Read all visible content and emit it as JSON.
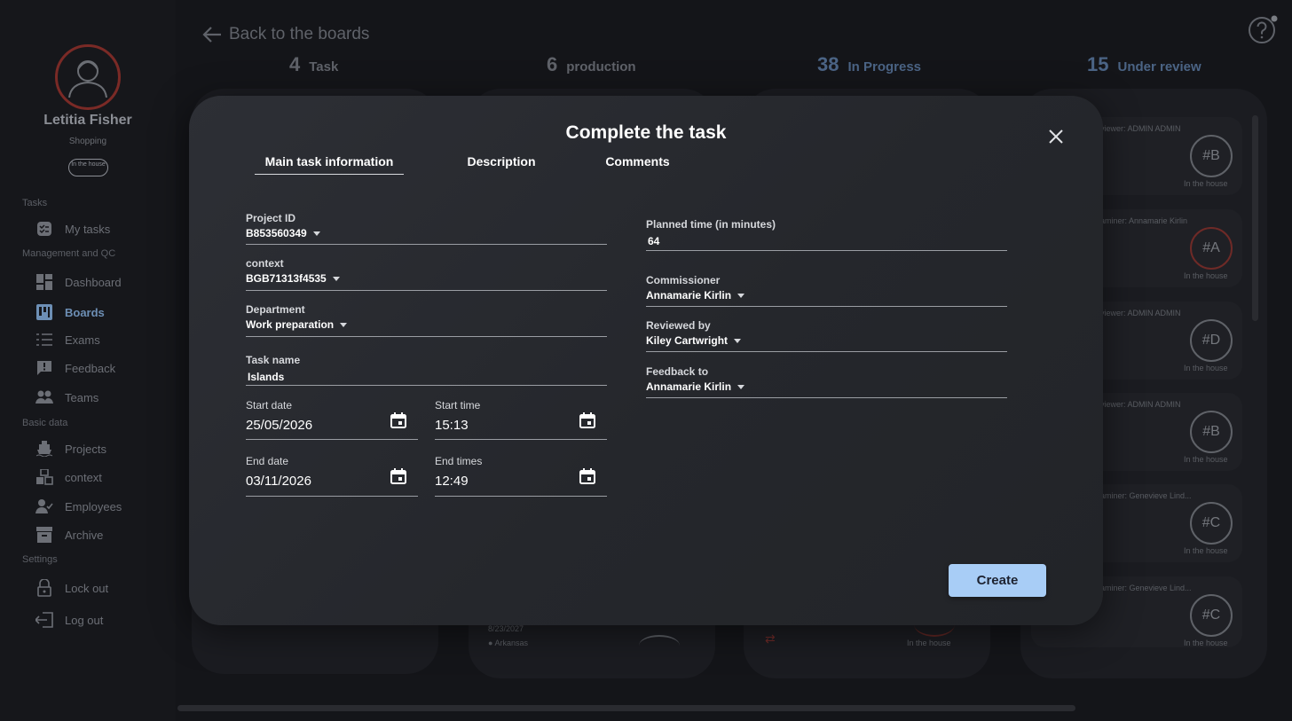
{
  "sidebar": {
    "user_name": "Letitia Fisher",
    "user_role": "Shopping",
    "user_status": "In the house",
    "sections": {
      "tasks": "Tasks",
      "management": "Management and QC",
      "basic": "Basic data",
      "settings": "Settings"
    },
    "items": {
      "my_tasks": "My tasks",
      "dashboard": "Dashboard",
      "boards": "Boards",
      "exams": "Exams",
      "feedback": "Feedback",
      "teams": "Teams",
      "projects": "Projects",
      "context": "context",
      "employees": "Employees",
      "archive": "Archive",
      "lock_out": "Lock out",
      "log_out": "Log out"
    }
  },
  "header": {
    "back_label": "Back to the boards"
  },
  "columns": [
    {
      "count": "4",
      "label": "Task"
    },
    {
      "count": "6",
      "label": "production"
    },
    {
      "count": "38",
      "label": "In Progress"
    },
    {
      "count": "15",
      "label": "Under review"
    }
  ],
  "review_cards": [
    {
      "who": "viewer: ADMIN ADMIN",
      "code": "#B",
      "loc": "In the house"
    },
    {
      "who": "aminer: Annamarie Kirlin",
      "code": "#A",
      "loc": "In the house"
    },
    {
      "who": "viewer: ADMIN ADMIN",
      "code": "#D",
      "loc": "In the house"
    },
    {
      "who": "viewer: ADMIN ADMIN",
      "code": "#B",
      "loc": "In the house"
    },
    {
      "who": "aminer: Genevieve Lind...",
      "code": "#C",
      "loc": "In the house"
    },
    {
      "who": "aminer: Genevieve Lind...",
      "code": "#C",
      "loc": "In the house"
    }
  ],
  "peek": {
    "date": "8/23/2027",
    "text": "● Arkansas",
    "loc": "In the house"
  },
  "modal": {
    "title": "Complete the task",
    "tabs": {
      "main": "Main task information",
      "description": "Description",
      "comments": "Comments"
    },
    "fields": {
      "project_id": {
        "label": "Project ID",
        "value": "B853560349"
      },
      "context": {
        "label": "context",
        "value": "BGB71313f4535"
      },
      "department": {
        "label": "Department",
        "value": "Work preparation"
      },
      "task_name": {
        "label": "Task name",
        "value": "Islands"
      },
      "start_date": {
        "label": "Start date",
        "value": "25/05/2026"
      },
      "start_time": {
        "label": "Start time",
        "value": "15:13"
      },
      "end_date": {
        "label": "End date",
        "value": "03/11/2026"
      },
      "end_time": {
        "label": "End times",
        "value": "12:49"
      },
      "planned_time": {
        "label": "Planned time (in minutes)",
        "value": "64"
      },
      "commissioner": {
        "label": "Commissioner",
        "value": "Annamarie Kirlin"
      },
      "reviewed_by": {
        "label": "Reviewed by",
        "value": "Kiley Cartwright"
      },
      "feedback_to": {
        "label": "Feedback to",
        "value": "Annamarie Kirlin"
      }
    },
    "create_label": "Create"
  },
  "colors": {
    "accent": "#a8cdf6",
    "active_nav": "#6d8fb5",
    "alert_red": "#7a2a26",
    "modal_bg": "#2a2c31"
  }
}
